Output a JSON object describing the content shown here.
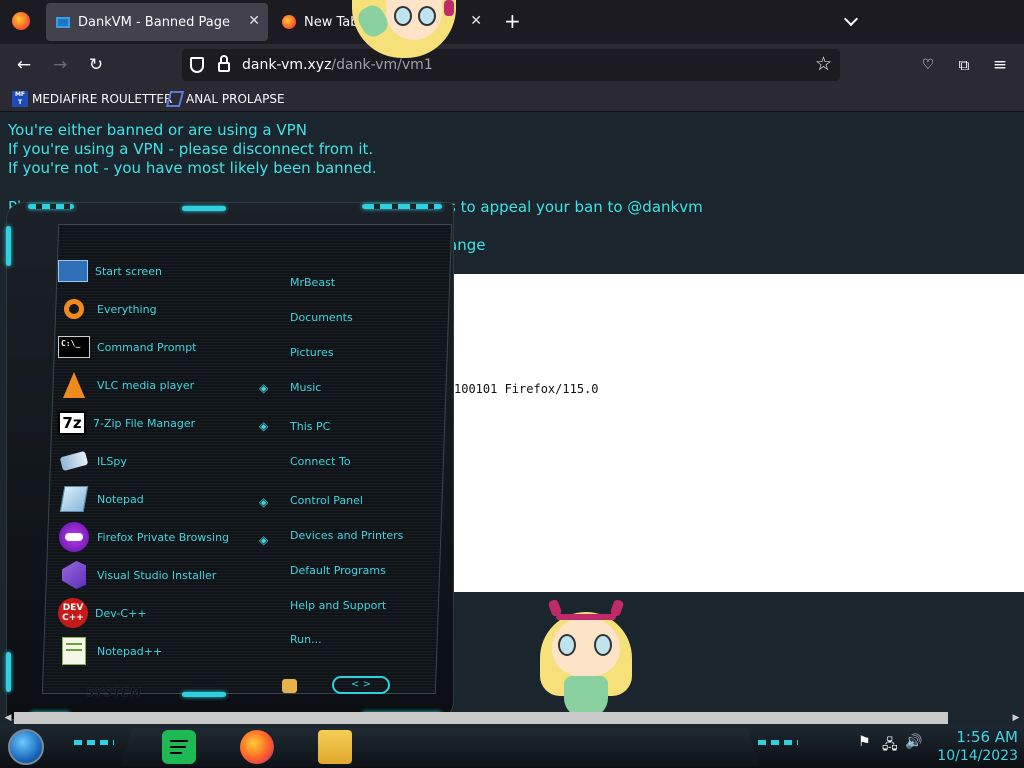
{
  "browser": {
    "tabs": [
      {
        "title": "DankVM - Banned Page",
        "active": true
      },
      {
        "title": "New Tab",
        "active": false
      }
    ],
    "new_tab_icon": "plus-icon",
    "list_tabs_icon": "chevron-down-icon",
    "url": {
      "host": "dank-vm.xyz",
      "path": "/dank-vm/vm1"
    },
    "bookmarks": [
      {
        "label": "MEDIAFIRE ROULETTER",
        "icon_text": "MF T"
      },
      {
        "label": "ANAL PROLAPSE"
      }
    ]
  },
  "page": {
    "lines": [
      "You're either banned or are using a VPN",
      "If you're using a VPN - please disconnect from it.",
      "If you're not - you have most likely been banned.",
      "Pl",
      "s to appeal your ban to @dankvm",
      "ange"
    ],
    "useragent_fragment": "100101 Firefox/115.0"
  },
  "start_menu": {
    "programs": [
      {
        "label": "Start screen"
      },
      {
        "label": "Everything"
      },
      {
        "label": "Command Prompt",
        "icon_text": "C:\\_"
      },
      {
        "label": "VLC media player"
      },
      {
        "label": "7-Zip File Manager",
        "icon_text": "7z"
      },
      {
        "label": "ILSpy"
      },
      {
        "label": "Notepad"
      },
      {
        "label": "Firefox Private Browsing"
      },
      {
        "label": "Visual Studio Installer"
      },
      {
        "label": "Dev-C++",
        "icon_text": "DEV C++"
      },
      {
        "label": "Notepad++"
      }
    ],
    "places": [
      "MrBeast",
      "Documents",
      "Pictures",
      "Music",
      "This PC",
      "Connect To",
      "Control Panel",
      "Devices and Printers",
      "Default Programs",
      "Help and Support",
      "Run..."
    ],
    "system_label": "SYSTEM",
    "power_arrows": "< >"
  },
  "taskbar": {
    "time": "1:56 AM",
    "date": "10/14/2023",
    "pinned": [
      "spotify-icon",
      "firefox-icon",
      "file-explorer-icon"
    ],
    "tray": [
      "flag-icon",
      "network-icon",
      "volume-icon"
    ]
  },
  "colors": {
    "accent": "#3fe2e6",
    "page_bg": "#1b252d",
    "menu_text": "#3fd4e0"
  }
}
